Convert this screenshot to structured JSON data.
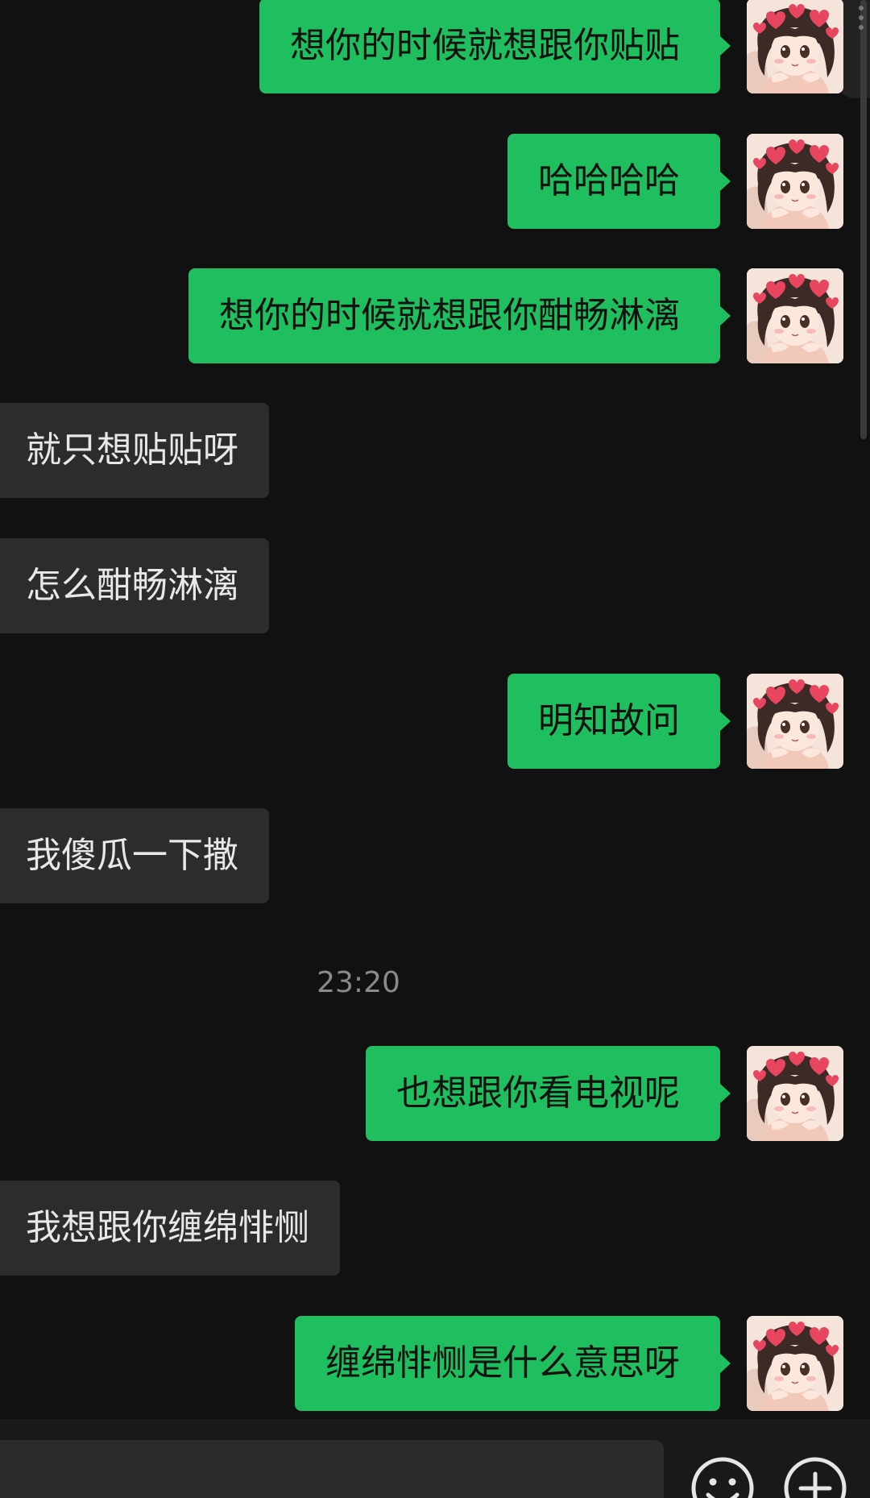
{
  "chat": {
    "messages": [
      {
        "side": "out",
        "text": "想你的时候就想跟你贴贴"
      },
      {
        "side": "out",
        "text": "哈哈哈哈"
      },
      {
        "side": "out",
        "text": "想你的时候就想跟你酣畅淋漓"
      },
      {
        "side": "in",
        "text": "就只想贴贴呀"
      },
      {
        "side": "in",
        "text": "怎么酣畅淋漓"
      },
      {
        "side": "out",
        "text": "明知故问"
      },
      {
        "side": "in",
        "text": "我傻瓜一下撒"
      },
      {
        "side": "out",
        "text": "也想跟你看电视呢"
      },
      {
        "side": "in",
        "text": "我想跟你缠绵悱恻"
      },
      {
        "side": "out",
        "text": "缠绵悱恻是什么意思呀"
      }
    ],
    "timestamp": "23:20"
  },
  "input_bar": {
    "text": "",
    "icons": [
      "emoji-icon",
      "plus-icon"
    ]
  },
  "colors": {
    "background": "#111111",
    "outgoing_bubble": "#1fbf5f",
    "incoming_bubble": "#2c2c2c",
    "incoming_text": "#e8e8e8",
    "timestamp": "#8a8a8a"
  }
}
